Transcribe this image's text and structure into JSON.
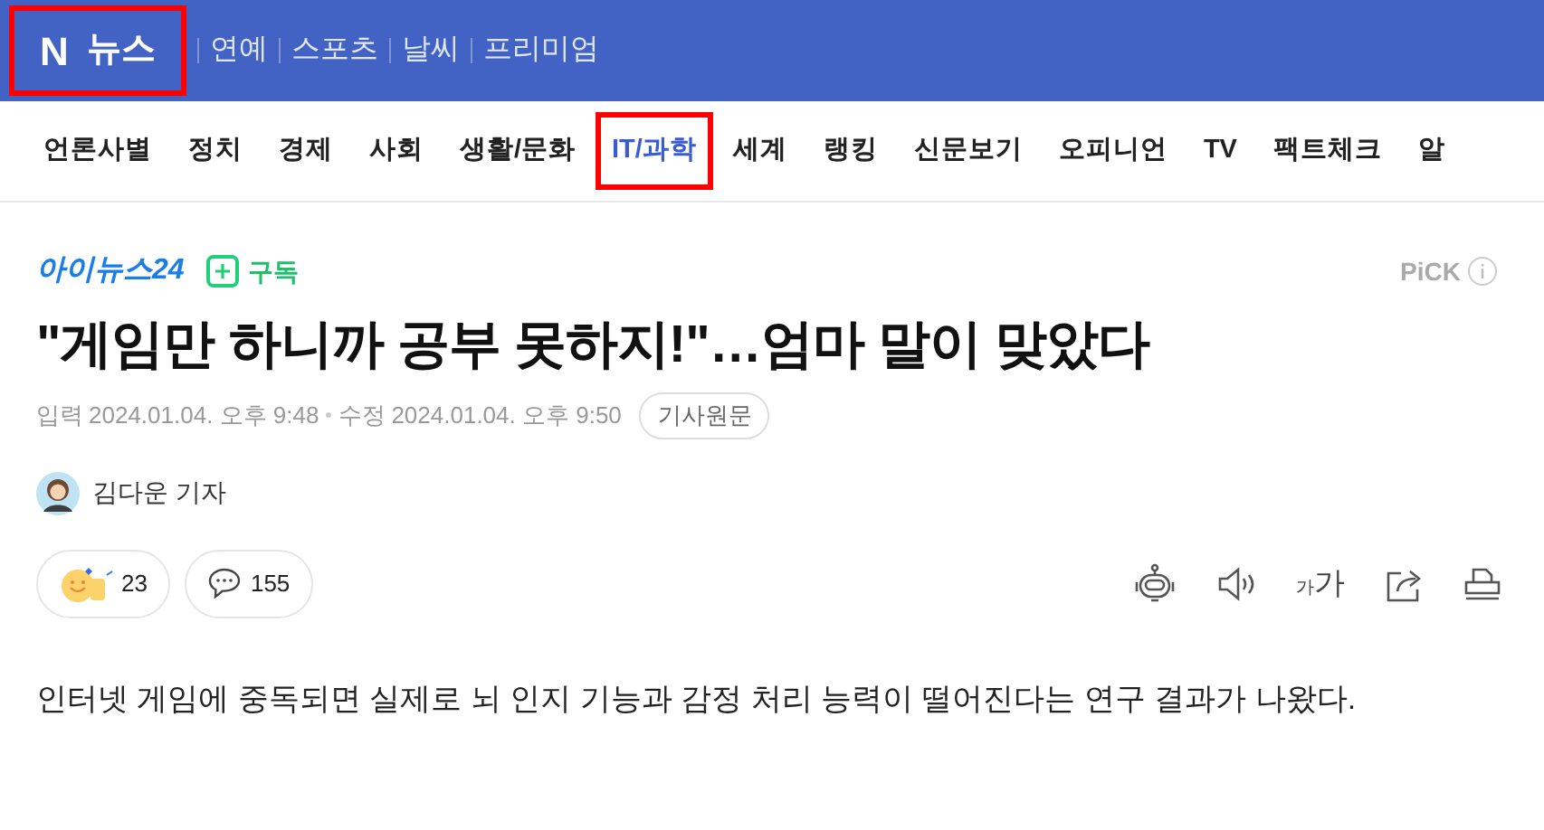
{
  "top_bar": {
    "logo_letter": "N",
    "logo_text": "뉴스",
    "logo_highlighted": true,
    "links": [
      "연예",
      "스포츠",
      "날씨",
      "프리미엄"
    ]
  },
  "category_nav": [
    {
      "label": "언론사별",
      "selected": false,
      "highlighted": false
    },
    {
      "label": "정치",
      "selected": false,
      "highlighted": false
    },
    {
      "label": "경제",
      "selected": false,
      "highlighted": false
    },
    {
      "label": "사회",
      "selected": false,
      "highlighted": false
    },
    {
      "label": "생활/문화",
      "selected": false,
      "highlighted": false
    },
    {
      "label": "IT/과학",
      "selected": true,
      "highlighted": true
    },
    {
      "label": "세계",
      "selected": false,
      "highlighted": false
    },
    {
      "label": "랭킹",
      "selected": false,
      "highlighted": false
    },
    {
      "label": "신문보기",
      "selected": false,
      "highlighted": false
    },
    {
      "label": "오피니언",
      "selected": false,
      "highlighted": false
    },
    {
      "label": "TV",
      "selected": false,
      "highlighted": false
    },
    {
      "label": "팩트체크",
      "selected": false,
      "highlighted": false
    },
    {
      "label": "알",
      "selected": false,
      "highlighted": false
    }
  ],
  "article": {
    "press": "아이뉴스24",
    "subscribe": "구독",
    "pick": "PiCK",
    "headline": "\"게임만 하니까 공부 못하지!\"…엄마 말이 맞았다",
    "published_label": "입력",
    "published": "2024.01.04. 오후 9:48",
    "modified_label": "수정",
    "modified": "2024.01.04. 오후 9:50",
    "original_link": "기사원문",
    "reporter": "김다운 기자",
    "reactions": "23",
    "comments": "155",
    "font_size_small": "가",
    "font_size_large": "가",
    "body": "인터넷 게임에 중독되면 실제로 뇌 인지 기능과 감정 처리 능력이 떨어진다는 연구 결과가 나왔다."
  }
}
